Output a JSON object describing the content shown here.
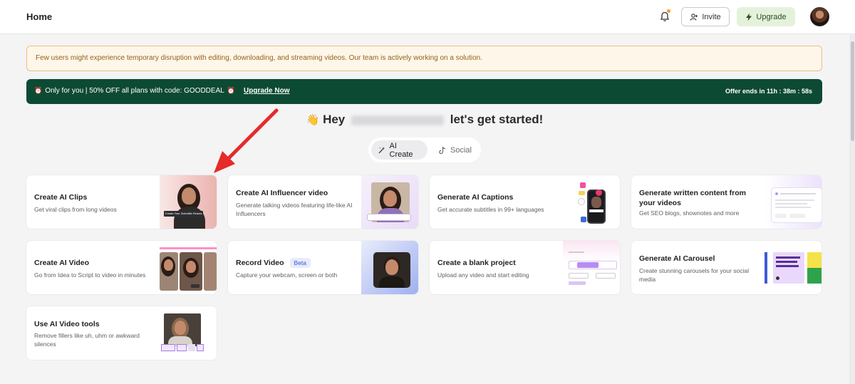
{
  "header": {
    "title": "Home",
    "invite_label": "Invite",
    "upgrade_label": "Upgrade",
    "icons": [
      "bell-icon",
      "user-plus-icon",
      "bolt-icon",
      "avatar"
    ]
  },
  "notice": {
    "text": "Few users might experience temporary disruption with editing, downloading, and streaming videos. Our team is actively working on a solution."
  },
  "promo": {
    "text": "Only for you | 50% OFF all plans with code: GOODDEAL",
    "link": "Upgrade Now",
    "offer": "Offer ends in 11h : 38m : 58s"
  },
  "greeting": {
    "wave": "👋",
    "hey": "Hey",
    "rest": "let's get started!"
  },
  "tabs": {
    "ai_create": "AI Create",
    "social": "Social",
    "active": "ai_create"
  },
  "cards": [
    {
      "title": "Create AI Clips",
      "desc": "Get viral clips from long videos",
      "thumb_caption": "Create Your Scientific Reacts"
    },
    {
      "title": "Create AI Influencer video",
      "desc": "Generate talking videos featuring life-like AI Influencers"
    },
    {
      "title": "Generate AI Captions",
      "desc": "Get accurate subtitles in 99+ languages"
    },
    {
      "title": "Generate written content from your videos",
      "desc": "Get SEO blogs, shownotes and more"
    },
    {
      "title": "Create AI Video",
      "desc": "Go from Idea to Script to video in minutes"
    },
    {
      "title": "Record Video",
      "badge": "Beta",
      "desc": "Capture your webcam, screen or both"
    },
    {
      "title": "Create a blank project",
      "desc": "Upload any video and start editing"
    },
    {
      "title": "Generate AI Carousel",
      "desc": "Create stunning carousels for your social media"
    },
    {
      "title": "Use AI Video tools",
      "desc": "Remove fillers like uh, uhm or awkward silences"
    }
  ],
  "colors": {
    "promo_bg": "#0d4a34",
    "notice_bg": "#fdf6e9",
    "upgrade_bg": "#e4f2dc",
    "arrow": "#e52b2b"
  }
}
